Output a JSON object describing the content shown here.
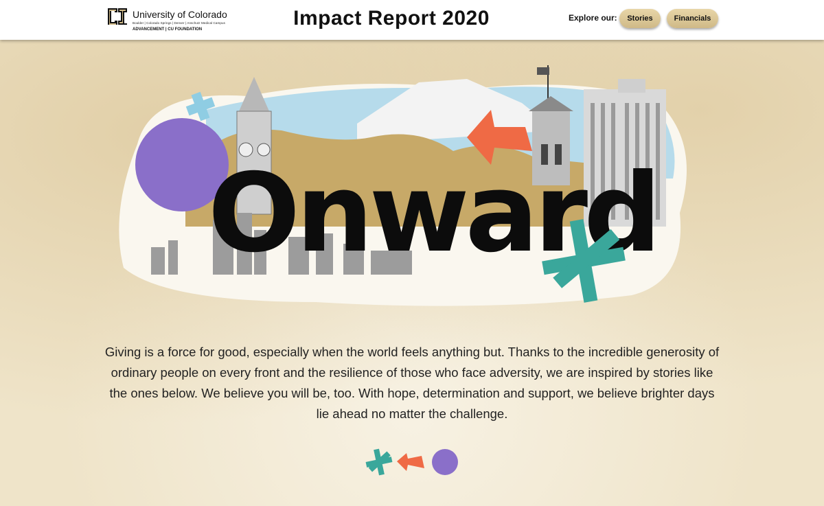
{
  "header": {
    "logo": {
      "name": "University of Colorado",
      "campuses": "Boulder | Colorado Springs | Denver | Anschutz Medical Campus",
      "subtitle": "ADVANCEMENT | CU FOUNDATION"
    },
    "title": "Impact Report 2020",
    "explore_label": "Explore our:",
    "nav": [
      {
        "label": "Stories"
      },
      {
        "label": "Financials"
      }
    ]
  },
  "hero": {
    "wordmark": "Onward",
    "icons": [
      "asterisk-icon",
      "arrow-icon",
      "circle-icon",
      "flag-icon"
    ]
  },
  "intro": {
    "text": "Giving is a force for good, especially when the world feels anything but. Thanks to the incredible generosity of ordinary people on every front and the resilience of those who face adversity, we are inspired by stories like the ones below. We believe you will be, too. With hope, determination and support, we believe brighter days lie ahead no matter the challenge."
  },
  "colors": {
    "accent_gold": "#cfb987",
    "teal": "#3aa79b",
    "coral": "#ef6a45",
    "purple": "#8a6fc9",
    "sky": "#a9d6ea",
    "mountain": "#c7a968"
  }
}
